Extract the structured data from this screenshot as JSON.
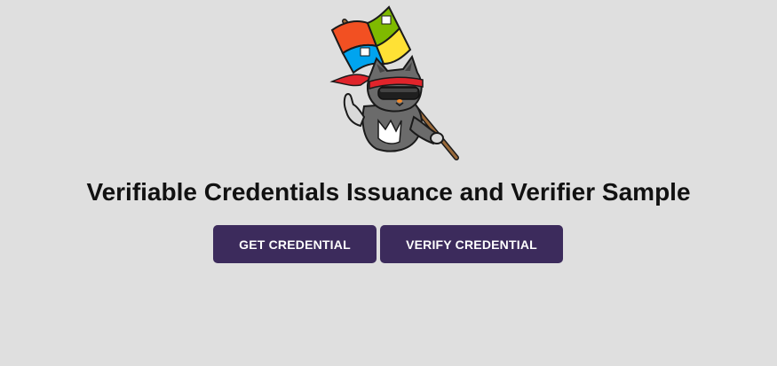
{
  "page": {
    "title": "Verifiable Credentials Issuance and Verifier Sample"
  },
  "mascot": {
    "icon": "ninja-cat-with-windows-flag-icon"
  },
  "actions": {
    "get_credential_label": "GET CREDENTIAL",
    "verify_credential_label": "VERIFY CREDENTIAL"
  },
  "colors": {
    "background": "#dfdfdf",
    "button_bg": "#3c2b5c",
    "button_text": "#ffffff",
    "title_text": "#111111"
  }
}
